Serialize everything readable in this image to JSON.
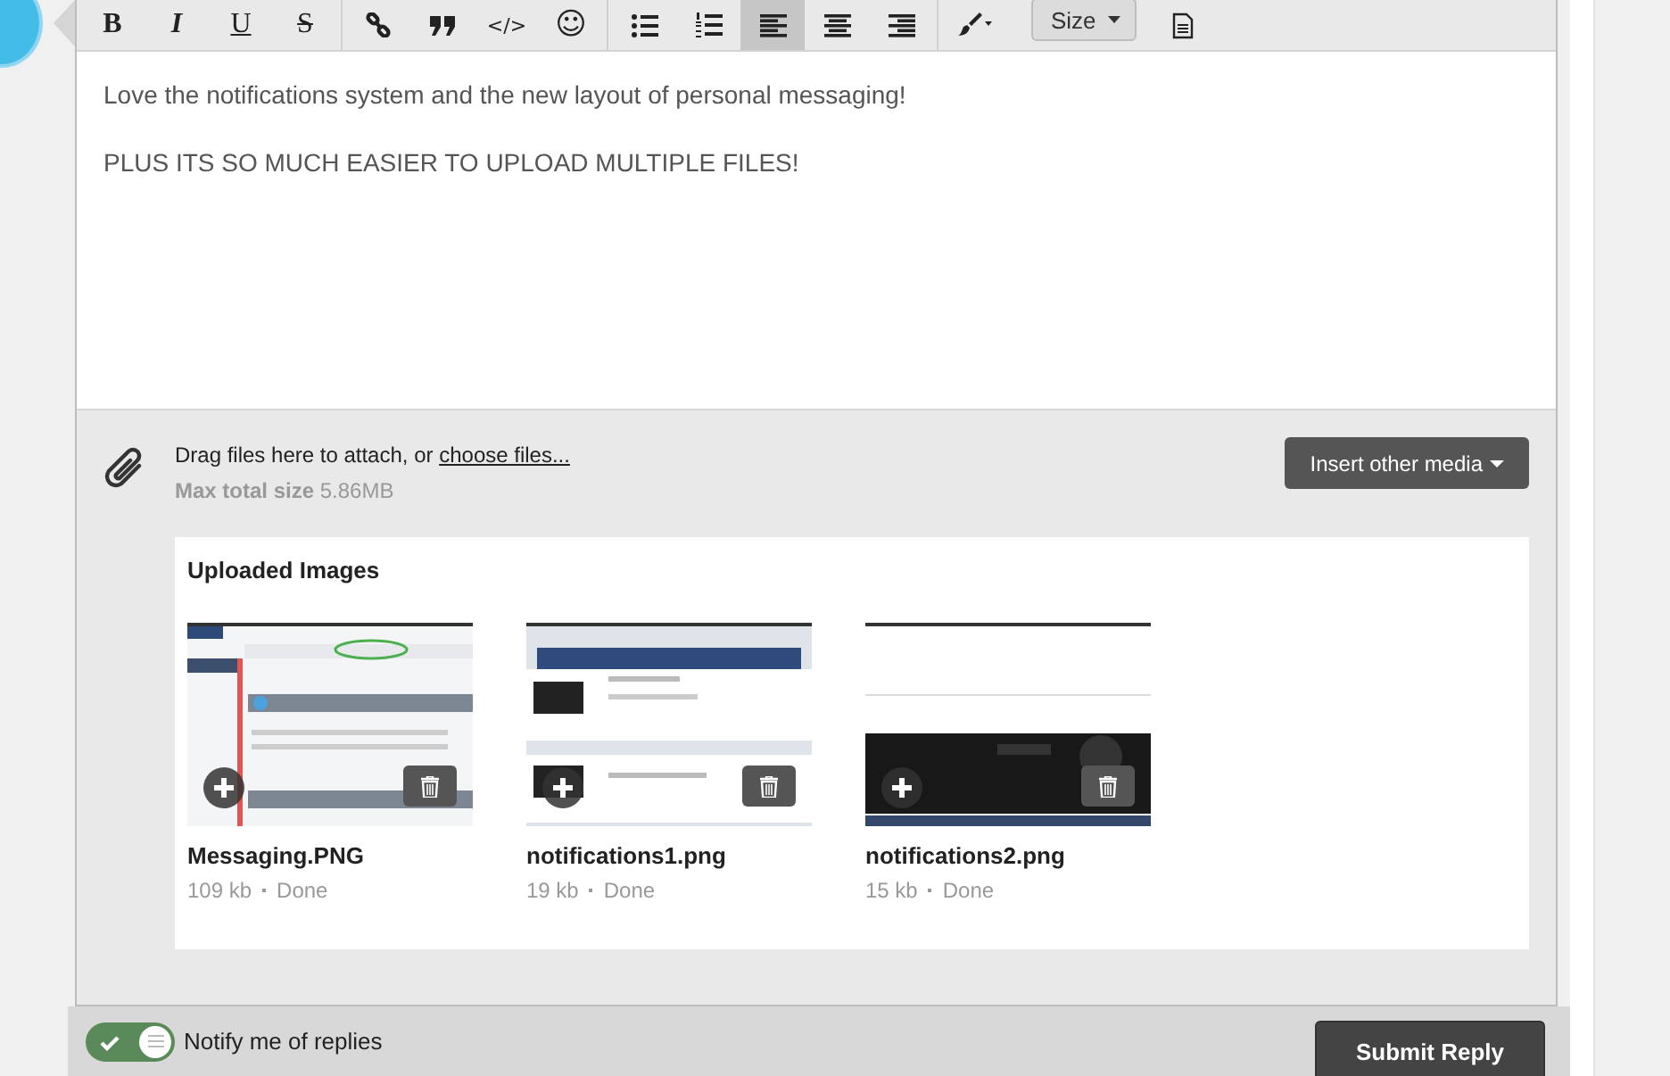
{
  "toolbar": {
    "groups": [
      [
        {
          "kind": "bold",
          "label": "B",
          "selected": false
        },
        {
          "kind": "italic",
          "label": "I",
          "selected": false
        },
        {
          "kind": "underline",
          "label": "U",
          "selected": false
        },
        {
          "kind": "strike",
          "label": "S",
          "selected": false
        }
      ],
      [
        {
          "kind": "link",
          "selected": false
        },
        {
          "kind": "quote",
          "selected": false
        },
        {
          "kind": "code",
          "label": "</>",
          "selected": false
        },
        {
          "kind": "smiley",
          "label": "☺",
          "selected": false
        }
      ],
      [
        {
          "kind": "bullets",
          "selected": false
        },
        {
          "kind": "numbers",
          "selected": false
        },
        {
          "kind": "align-left",
          "selected": true
        },
        {
          "kind": "align-center",
          "selected": false
        },
        {
          "kind": "align-right",
          "selected": false
        }
      ],
      [
        {
          "kind": "brush",
          "selected": false
        },
        {
          "kind": "size",
          "label": "Size",
          "selected": false
        },
        {
          "kind": "source",
          "selected": false
        }
      ]
    ]
  },
  "editor": {
    "paragraphs": [
      "Love the notifications system and the new layout of personal messaging!",
      "PLUS ITS SO MUCH EASIER TO UPLOAD MULTIPLE FILES!"
    ]
  },
  "attachments": {
    "drag_text": "Drag files here to attach, or",
    "choose_link": "choose files...",
    "max_label": "Max total size",
    "max_value": "5.86MB",
    "insert_button": "Insert other media",
    "uploaded_title": "Uploaded Images",
    "files": [
      {
        "name": "Messaging.PNG",
        "size": "109 kb",
        "status": "Done",
        "kind": "picture"
      },
      {
        "name": "notifications1.png",
        "size": "19 kb",
        "status": "Done",
        "kind": "picture"
      },
      {
        "name": "notifications2.png",
        "size": "15 kb",
        "status": "Done",
        "kind": "picture"
      }
    ]
  },
  "footer": {
    "notify": {
      "label": "Notify me of replies",
      "on": true
    },
    "submit": "Submit Reply"
  }
}
